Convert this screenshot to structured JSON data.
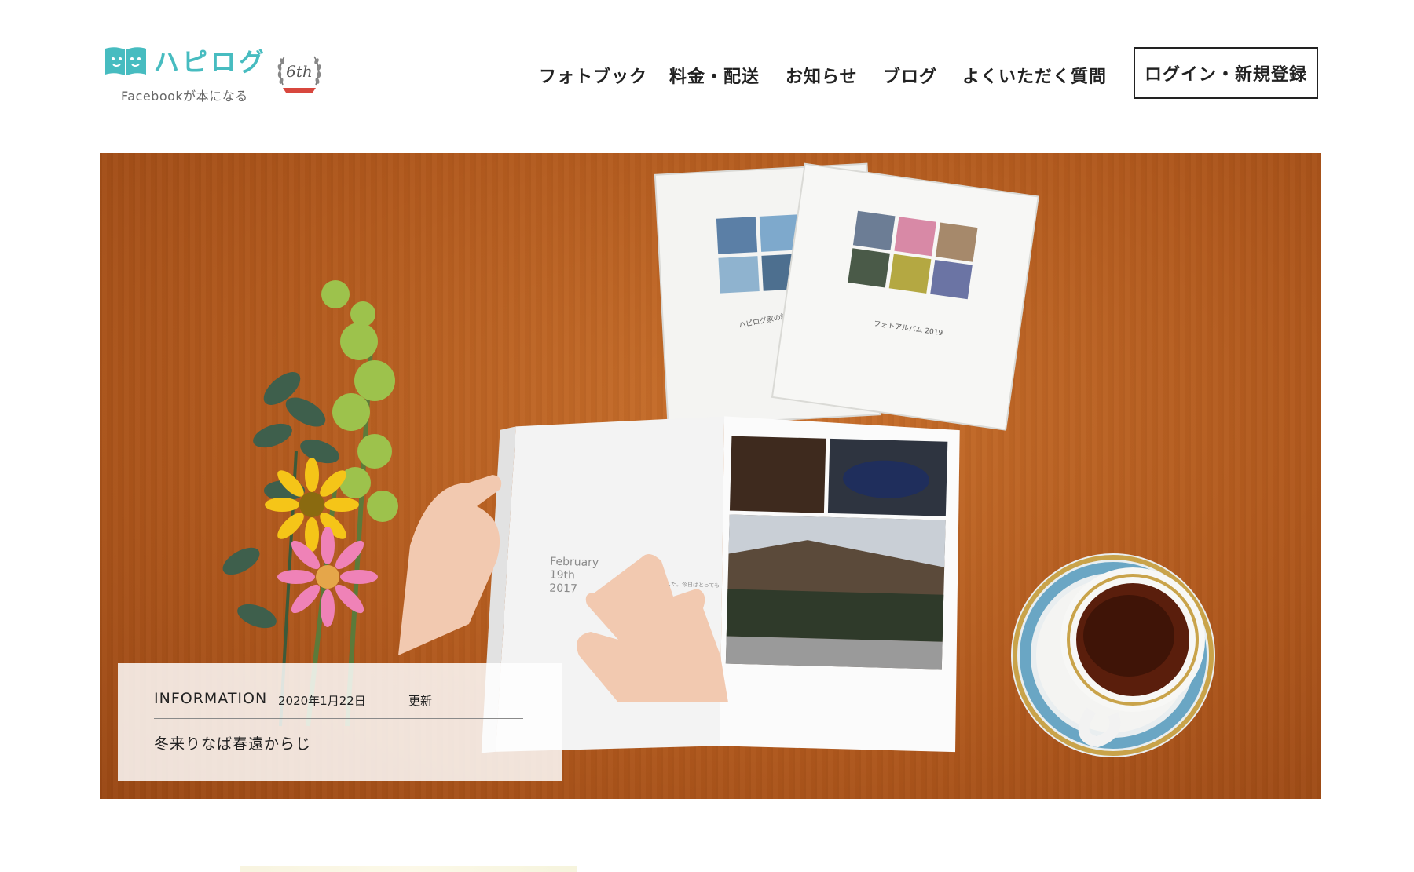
{
  "brand": {
    "name": "ハピログ",
    "tagline": "Facebookが本になる",
    "anniversary": "6th",
    "logo_color": "#47bcc0",
    "icon": "book-icon",
    "badge_icon": "laurel-badge-icon"
  },
  "nav": {
    "items": [
      {
        "label": "フォトブック"
      },
      {
        "label": "料金・配送"
      },
      {
        "label": "お知らせ"
      },
      {
        "label": "ブログ"
      },
      {
        "label": "よくいただく質問"
      }
    ],
    "login_label": "ログイン・新規登録"
  },
  "hero": {
    "book_left_title": "ハピログ家の記録",
    "book_right_title": "フォトアルバム 2019",
    "open_book_date_lines": [
      "February",
      "19th",
      "2017"
    ],
    "open_book_caption": "過去最高の1日でした。今日はとっても"
  },
  "info": {
    "label": "INFORMATION",
    "date": "2020年1月22日",
    "updated": "更新",
    "title": "冬来りなば春遠からじ"
  },
  "colors": {
    "table_wood": "#b25a1e",
    "text": "#222222",
    "accent": "#47bcc0"
  }
}
